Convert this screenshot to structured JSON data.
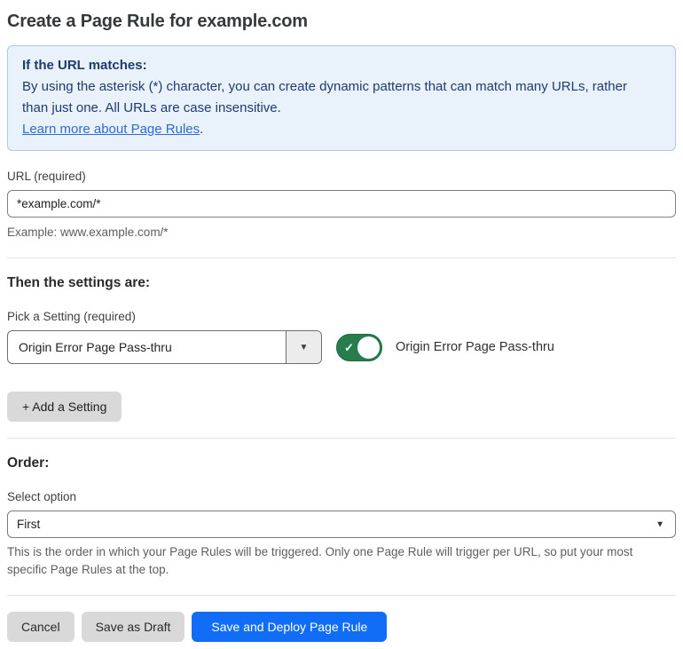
{
  "page": {
    "title": "Create a Page Rule for example.com"
  },
  "info_box": {
    "heading": "If the URL matches:",
    "body": "By using the asterisk (*) character, you can create dynamic patterns that can match many URLs, rather than just one. All URLs are case insensitive.",
    "link_label": "Learn more about Page Rules",
    "link_suffix": "."
  },
  "url_field": {
    "label": "URL (required)",
    "value": "*example.com/*",
    "helper": "Example: www.example.com/*"
  },
  "settings_section": {
    "heading": "Then the settings are:",
    "picker_label": "Pick a Setting (required)",
    "picker_value": "Origin Error Page Pass-thru",
    "toggle_state": "on",
    "toggle_label": "Origin Error Page Pass-thru",
    "add_setting_label": "+ Add a Setting"
  },
  "order_section": {
    "heading": "Order:",
    "select_label": "Select option",
    "select_value": "First",
    "helper": "This is the order in which your Page Rules will be triggered. Only one Page Rule will trigger per URL, so put your most specific Page Rules at the top."
  },
  "footer": {
    "cancel_label": "Cancel",
    "save_draft_label": "Save as Draft",
    "save_deploy_label": "Save and Deploy Page Rule"
  },
  "icons": {
    "caret_down": "▼",
    "check": "✓"
  },
  "colors": {
    "accent_blue": "#116df6",
    "info_background": "#e9f1fb",
    "info_border": "#abc9ec",
    "info_text": "#1d3c6e",
    "link_blue": "#2d6bd0",
    "toggle_green": "#267d4d",
    "button_gray": "#d9d9d9"
  }
}
